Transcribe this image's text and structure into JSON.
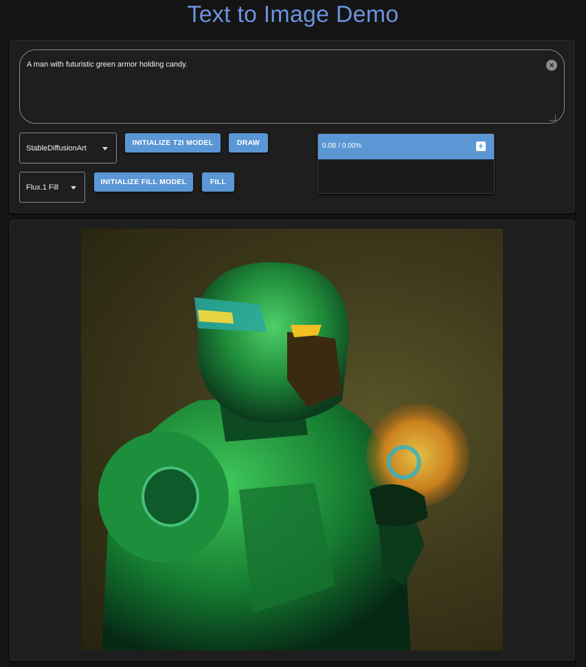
{
  "page": {
    "title": "Text to Image Demo"
  },
  "prompt": {
    "value": "A man with futuristic green armor holding candy."
  },
  "controls": {
    "model_select": "StableDiffusionArt",
    "init_t2i_label": "INITIALIZE T2I MODEL",
    "draw_label": "DRAW",
    "fill_select": "Flux.1 Fill",
    "init_fill_label": "INITIALIZE FILL MODEL",
    "fill_label": "FILL"
  },
  "progress": {
    "text": "0.0B / 0.00%"
  },
  "icons": {
    "clear": "clear-icon",
    "dropdown": "chevron-down-icon",
    "expand": "plus-icon"
  },
  "colors": {
    "accent": "#5b97d4",
    "title": "#6b93dc",
    "background": "#141414",
    "panel": "#1e1e1e"
  },
  "image": {
    "description_visible": false
  }
}
